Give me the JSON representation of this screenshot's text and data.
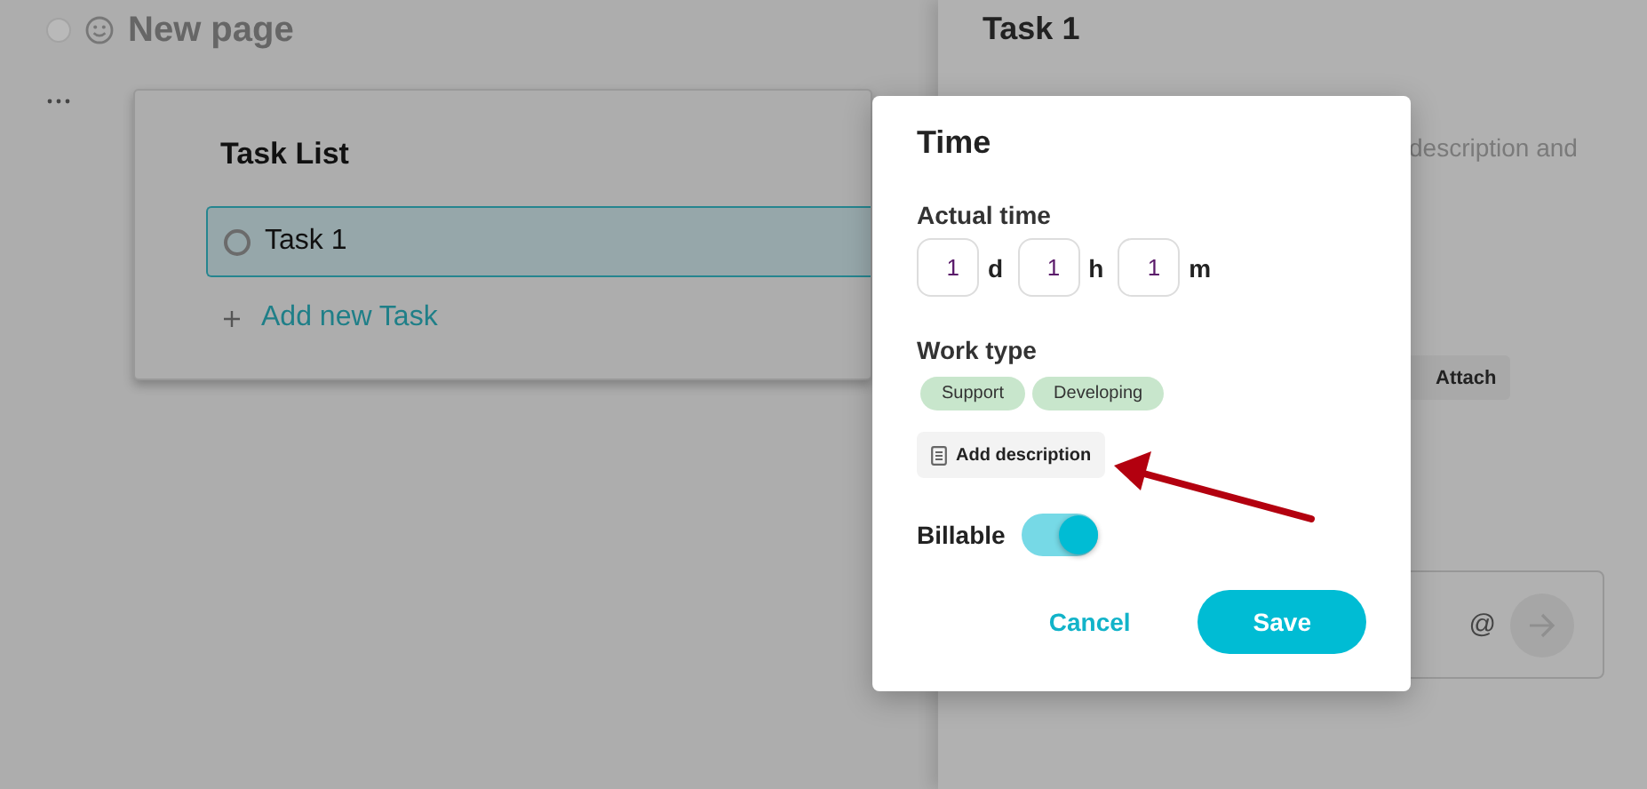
{
  "page": {
    "title": "New page"
  },
  "task_list": {
    "title": "Task List",
    "tasks": [
      {
        "name": "Task 1",
        "selected": true
      }
    ],
    "add_label": "Add new Task"
  },
  "detail": {
    "title": "Task 1",
    "description_fragment": "description and",
    "attach_label": "Attach",
    "mention_symbol": "@"
  },
  "dialog": {
    "title": "Time",
    "actual_time_label": "Actual time",
    "time_fields": [
      {
        "value": "1",
        "unit": "d"
      },
      {
        "value": "1",
        "unit": "h"
      },
      {
        "value": "1",
        "unit": "m"
      }
    ],
    "work_type_label": "Work type",
    "work_types": [
      "Support",
      "Developing"
    ],
    "add_description_label": "Add description",
    "billable": {
      "label": "Billable",
      "on": true
    },
    "buttons": [
      {
        "label": "Cancel",
        "kind": "secondary"
      },
      {
        "label": "Save",
        "kind": "primary"
      }
    ]
  }
}
